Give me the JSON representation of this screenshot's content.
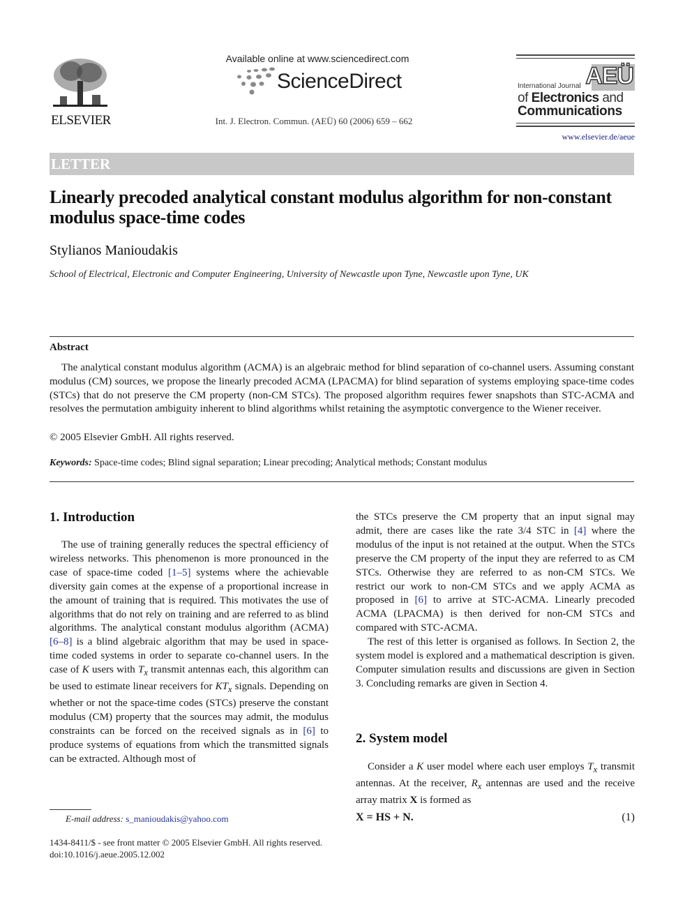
{
  "header": {
    "publisher": "ELSEVIER",
    "available_online": "Available online at www.sciencedirect.com",
    "platform": "ScienceDirect",
    "citation": "Int. J. Electron. Commun. (AEÜ) 60 (2006) 659 – 662",
    "journal_logo": {
      "acronym": "AEÜ",
      "line_intl": "International Journal",
      "line_of": "of",
      "line_electronics": "Electronics",
      "line_and": "and",
      "line_communications": "Communications"
    },
    "journal_url": "www.elsevier.de/aeue"
  },
  "article_type": "LETTER",
  "title": "Linearly precoded analytical constant modulus algorithm for non-constant modulus space-time codes",
  "author": "Stylianos Manioudakis",
  "affiliation": "School of Electrical, Electronic and Computer Engineering, University of Newcastle upon Tyne, Newcastle upon Tyne, UK",
  "abstract": {
    "heading": "Abstract",
    "text": "The analytical constant modulus algorithm (ACMA) is an algebraic method for blind separation of co-channel users. Assuming constant modulus (CM) sources, we propose the linearly precoded ACMA (LPACMA) for blind separation of systems employing space-time codes (STCs) that do not preserve the CM property (non-CM STCs). The proposed algorithm requires fewer snapshots than STC-ACMA and resolves the permutation ambiguity inherent to blind algorithms whilst retaining the asymptotic convergence to the Wiener receiver.",
    "copyright": "© 2005 Elsevier GmbH. All rights reserved."
  },
  "keywords": {
    "label": "Keywords:",
    "text": "Space-time codes; Blind signal separation; Linear precoding; Analytical methods; Constant modulus"
  },
  "sections": {
    "intro": {
      "heading": "1.  Introduction",
      "p1_a": "The use of training generally reduces the spectral efficiency of wireless networks. This phenomenon is more pronounced in the case of space-time coded ",
      "ref_1_5": "[1–5]",
      "p1_b": " systems where the achievable diversity gain comes at the expense of a proportional increase in the amount of training that is required. This motivates the use of algorithms that do not rely on training and are referred to as blind algorithms. The analytical constant modulus algorithm (ACMA) ",
      "ref_6_8": "[6–8]",
      "p1_c": " is a blind algebraic algorithm that may be used in space-time coded systems in order to separate co-channel users. In the case of ",
      "var_K": "K",
      "p1_d": " users with ",
      "var_T": "T",
      "var_x": "x",
      "p1_e": " transmit antennas each, this algorithm can be used to estimate linear receivers for ",
      "var_KT": "KT",
      "p1_f": " signals. Depending on whether or not the space-time codes (STCs) preserve the constant modulus (CM) property that the sources may admit, the modulus constraints can be forced on the received signals as in ",
      "ref_6": "[6]",
      "p1_g": " to produce systems of equations from which the transmitted signals can be extracted. Although most of the STCs preserve the CM property that an input signal may admit, there are cases like the rate 3/4 STC in ",
      "ref_4": "[4]",
      "p1_h": " where the modulus of the input is not retained at the output. When the STCs preserve the CM property of the input they are referred to as CM STCs. Otherwise they are referred to as non-CM STCs. We restrict our work to non-CM STCs and we apply ACMA as proposed in ",
      "ref_6b": "[6]",
      "p1_i": " to arrive at STC-ACMA. Linearly precoded ACMA (LPACMA) is then derived for non-CM STCs and compared with STC-ACMA.",
      "p2": "The rest of this letter is organised as follows. In Section 2, the system model is explored and a mathematical description is given. Computer simulation results and discussions are given in Section 3. Concluding remarks are given in Section 4."
    },
    "system_model": {
      "heading": "2.  System model",
      "p1_a": "Consider a ",
      "var_K": "K",
      "p1_b": " user model where each user employs ",
      "var_T": "T",
      "var_x": "x",
      "p1_c": " transmit antennas. At the receiver, ",
      "var_R": "R",
      "var_xr": "x",
      "p1_d": " antennas are used and the receive array matrix ",
      "var_X": "X",
      "p1_e": " is formed as",
      "equation": "X = HS + N.",
      "equation_number": "(1)"
    }
  },
  "footnote": {
    "email_label": "E-mail address:",
    "email": "s_manioudakis@yahoo.com",
    "front_matter": "1434-8411/$ - see front matter © 2005 Elsevier GmbH. All rights reserved.",
    "doi": "doi:10.1016/j.aeue.2005.12.002"
  }
}
